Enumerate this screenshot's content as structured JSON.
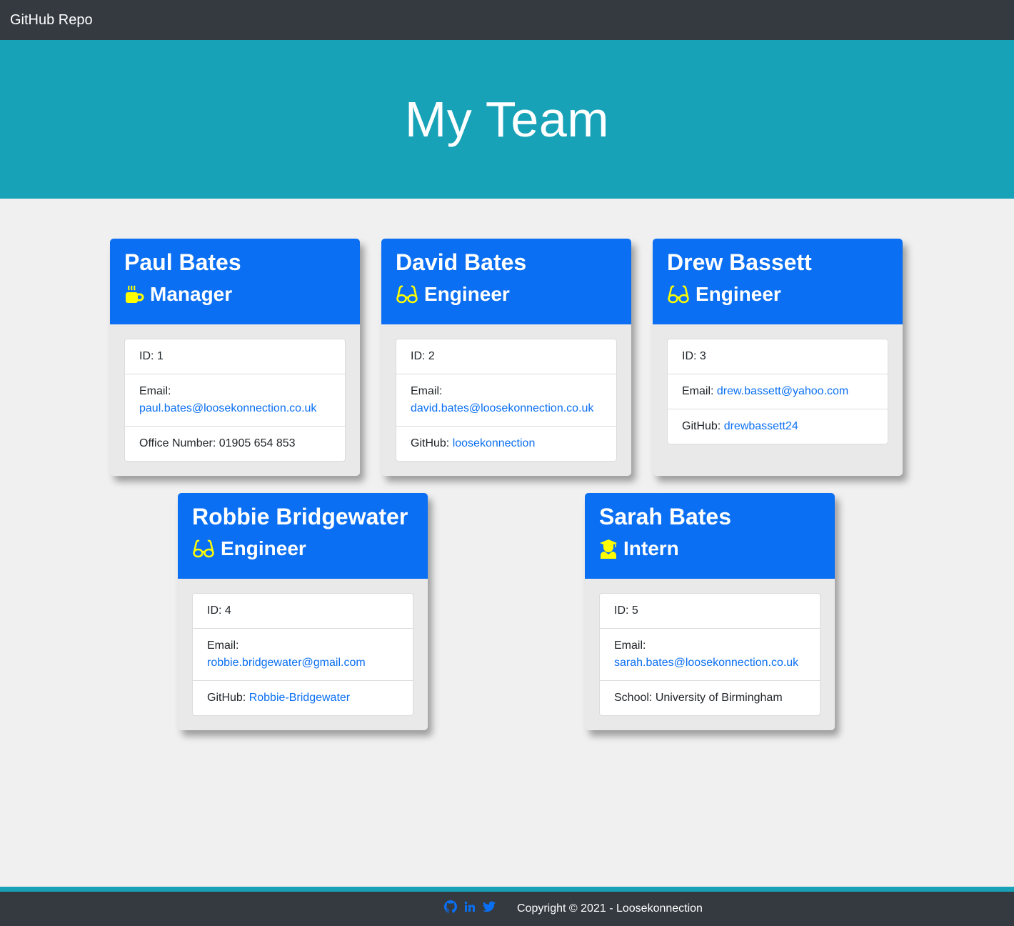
{
  "nav": {
    "title": "GitHub Repo"
  },
  "hero": {
    "title": "My Team"
  },
  "cards": [
    {
      "name": "Paul Bates",
      "role": "Manager",
      "icon": "coffee-icon",
      "id_label": "ID: 1",
      "email_label": "Email:",
      "email": "paul.bates@loosekonnection.co.uk",
      "extra_label": "Office Number: 01905 654 853",
      "extra_value": ""
    },
    {
      "name": "David Bates",
      "role": "Engineer",
      "icon": "glasses-icon",
      "id_label": "ID: 2",
      "email_label": "Email:",
      "email": "david.bates@loosekonnection.co.uk",
      "extra_label": "GitHub:",
      "extra_value": "loosekonnection"
    },
    {
      "name": "Drew Bassett",
      "role": "Engineer",
      "icon": "glasses-icon",
      "id_label": "ID: 3",
      "email_label": "Email:",
      "email": "drew.bassett@yahoo.com",
      "extra_label": "GitHub:",
      "extra_value": "drewbassett24"
    },
    {
      "name": "Robbie Bridgewater",
      "role": "Engineer",
      "icon": "glasses-icon",
      "id_label": "ID: 4",
      "email_label": "Email:",
      "email": "robbie.bridgewater@gmail.com",
      "extra_label": "GitHub:",
      "extra_value": "Robbie-Bridgewater"
    },
    {
      "name": "Sarah Bates",
      "role": "Intern",
      "icon": "graduate-icon",
      "id_label": "ID: 5",
      "email_label": "Email:",
      "email": "sarah.bates@loosekonnection.co.uk",
      "extra_label": "School: University of Birmingham",
      "extra_value": ""
    }
  ],
  "footer": {
    "copyright": "Copyright © 2021 - Loosekonnection",
    "icons": [
      "github-icon",
      "linkedin-icon",
      "twitter-icon"
    ]
  },
  "colors": {
    "navbar": "#343a40",
    "hero": "#17a2b8",
    "card_header": "#0a6ff2",
    "role_icon": "#ffff00",
    "link": "#0a6ff2"
  }
}
